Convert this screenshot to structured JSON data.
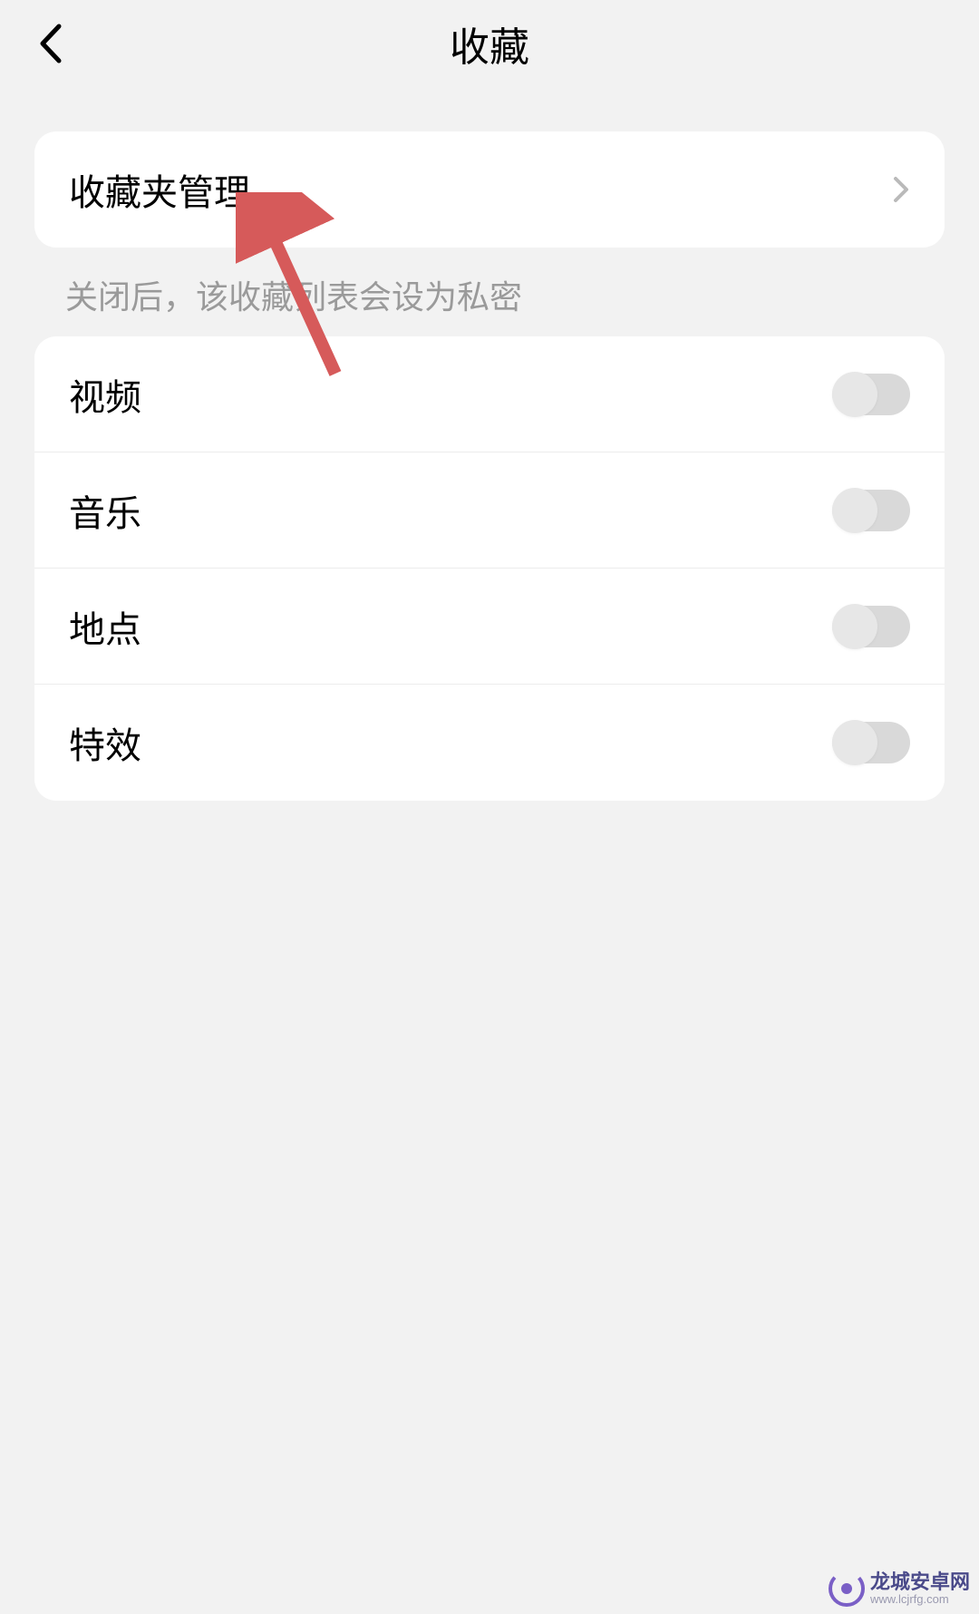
{
  "header": {
    "title": "收藏"
  },
  "management": {
    "label": "收藏夹管理"
  },
  "hint": "关闭后，该收藏列表会设为私密",
  "toggles": [
    {
      "label": "视频",
      "on": false
    },
    {
      "label": "音乐",
      "on": false
    },
    {
      "label": "地点",
      "on": false
    },
    {
      "label": "特效",
      "on": false
    }
  ],
  "watermark": {
    "title": "龙城安卓网",
    "sub": "www.lcjrfg.com"
  }
}
